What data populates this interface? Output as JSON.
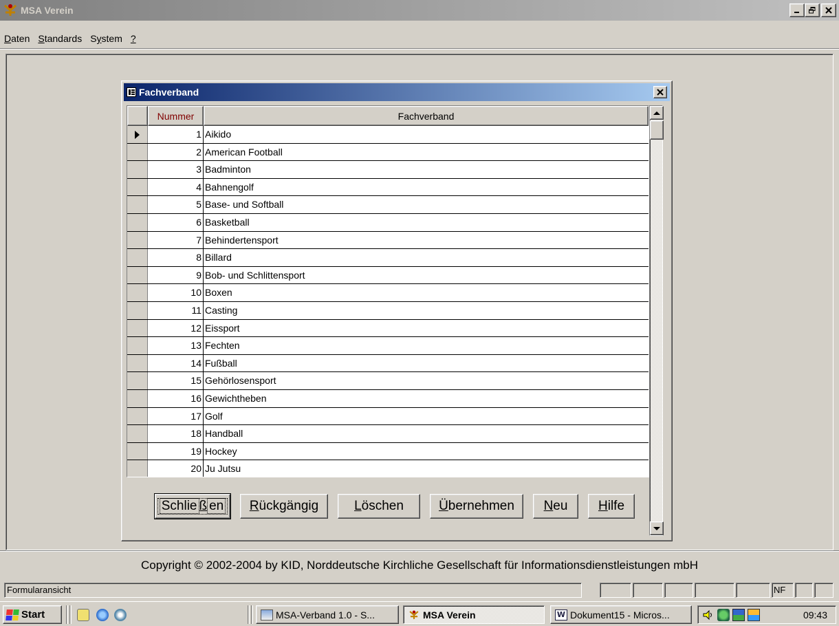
{
  "app": {
    "title": "MSA Verein"
  },
  "menu": {
    "items": [
      {
        "label_pre": "",
        "label_u": "D",
        "label_post": "aten"
      },
      {
        "label_pre": "",
        "label_u": "S",
        "label_post": "tandards"
      },
      {
        "label_pre": "S",
        "label_u": "y",
        "label_post": "stem"
      },
      {
        "label_pre": "",
        "label_u": "?",
        "label_post": ""
      }
    ]
  },
  "form": {
    "title": "Fachverband",
    "columns": {
      "nummer": "Nummer",
      "fachverband": "Fachverband"
    },
    "rows": [
      {
        "nummer": "1",
        "name": "Aikido"
      },
      {
        "nummer": "2",
        "name": "American Football"
      },
      {
        "nummer": "3",
        "name": "Badminton"
      },
      {
        "nummer": "4",
        "name": "Bahnengolf"
      },
      {
        "nummer": "5",
        "name": "Base- und Softball"
      },
      {
        "nummer": "6",
        "name": "Basketball"
      },
      {
        "nummer": "7",
        "name": "Behindertensport"
      },
      {
        "nummer": "8",
        "name": "Billard"
      },
      {
        "nummer": "9",
        "name": "Bob- und Schlittensport"
      },
      {
        "nummer": "10",
        "name": "Boxen"
      },
      {
        "nummer": "11",
        "name": "Casting"
      },
      {
        "nummer": "12",
        "name": "Eissport"
      },
      {
        "nummer": "13",
        "name": "Fechten"
      },
      {
        "nummer": "14",
        "name": "Fußball"
      },
      {
        "nummer": "15",
        "name": "Gehörlosensport"
      },
      {
        "nummer": "16",
        "name": "Gewichtheben"
      },
      {
        "nummer": "17",
        "name": "Golf"
      },
      {
        "nummer": "18",
        "name": "Handball"
      },
      {
        "nummer": "19",
        "name": "Hockey"
      },
      {
        "nummer": "20",
        "name": "Ju Jutsu"
      }
    ],
    "buttons": {
      "close": {
        "pre": "Schlie",
        "u": "ß",
        "post": "en"
      },
      "undo": {
        "pre": "",
        "u": "R",
        "post": "ückgängig"
      },
      "delete": {
        "pre": "",
        "u": "L",
        "post": "öschen"
      },
      "apply": {
        "pre": "",
        "u": "Ü",
        "post": "bernehmen"
      },
      "new": {
        "pre": "",
        "u": "N",
        "post": "eu"
      },
      "help": {
        "pre": "",
        "u": "H",
        "post": "ilfe"
      }
    }
  },
  "copyright": "Copyright © 2002-2004 by KID, Norddeutsche Kirchliche Gesellschaft für Informationsdienstleistungen mbH",
  "status": {
    "text": "Formularansicht",
    "nf": "NF"
  },
  "taskbar": {
    "start": "Start",
    "tasks": [
      {
        "label": "MSA-Verband 1.0 - S..."
      },
      {
        "label": "MSA Verein"
      },
      {
        "label": "Dokument15 - Micros..."
      }
    ],
    "clock": "09:43"
  },
  "colors": {
    "active_title_start": "#0a246a",
    "active_title_end": "#a6caf0",
    "inactive_title_start": "#808080",
    "face": "#d4d0c8",
    "column_header_text": "#800000"
  },
  "icons": [
    "msa-app-icon",
    "form-icon",
    "close-icon",
    "minimize-icon",
    "maximize-icon",
    "record-pointer-icon",
    "scroll-up-icon",
    "scroll-down-icon",
    "windows-logo-icon",
    "volume-icon"
  ]
}
